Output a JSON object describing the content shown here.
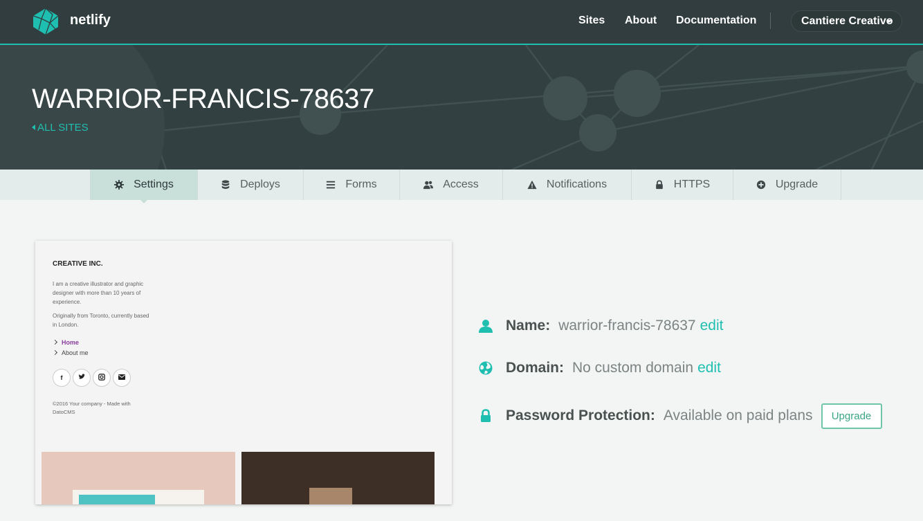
{
  "topnav": {
    "brand": "netlify",
    "links": [
      "Sites",
      "About",
      "Documentation"
    ],
    "team": "Cantiere Creativo"
  },
  "hero": {
    "title": "WARRIOR-FRANCIS-78637",
    "back_link": "ALL SITES"
  },
  "tabs": [
    {
      "label": "Settings",
      "icon": "gear-icon",
      "active": true
    },
    {
      "label": "Deploys",
      "icon": "database-icon",
      "active": false
    },
    {
      "label": "Forms",
      "icon": "list-icon",
      "active": false
    },
    {
      "label": "Access",
      "icon": "users-icon",
      "active": false
    },
    {
      "label": "Notifications",
      "icon": "warning-icon",
      "active": false
    },
    {
      "label": "HTTPS",
      "icon": "lock-icon",
      "active": false
    },
    {
      "label": "Upgrade",
      "icon": "plus-circle-icon",
      "active": false
    }
  ],
  "preview": {
    "company": "CREATIVE INC.",
    "intro": "I am a creative illustrator and graphic designer with more than 10 years of experience.",
    "location": "Originally from Toronto, currently based in London.",
    "nav": [
      "Home",
      "About me"
    ],
    "social": [
      "f",
      "t",
      "ig",
      "mail"
    ],
    "footer": "©2016 Your company - Made with DatoCMS"
  },
  "info": {
    "name_label": "Name:",
    "name_value": "warrior-francis-78637",
    "name_edit": "edit",
    "domain_label": "Domain:",
    "domain_value": "No custom domain",
    "domain_edit": "edit",
    "password_label": "Password Protection:",
    "password_value": "Available on paid plans",
    "upgrade_button": "Upgrade"
  },
  "colors": {
    "accent": "#1ebfb0",
    "topbar": "#313d3e",
    "hero": "#334041"
  }
}
